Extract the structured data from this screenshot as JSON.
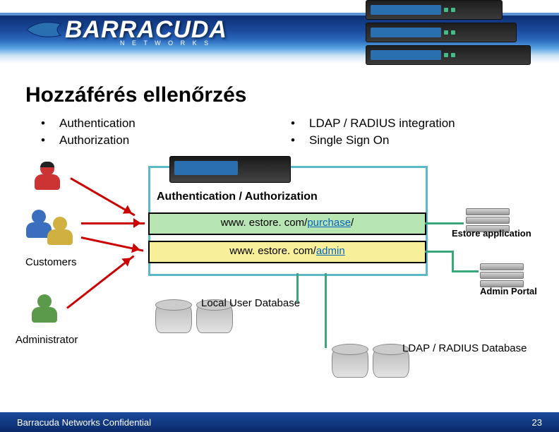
{
  "brand": {
    "name": "BARRACUDA",
    "sub": "N E T W O R K S"
  },
  "slide": {
    "title": "Hozzáférés ellenőrzés"
  },
  "bullets": {
    "left": [
      "Authentication",
      "Authorization"
    ],
    "right": [
      "LDAP / RADIUS integration",
      "Single Sign On"
    ]
  },
  "diagram": {
    "auth_label": "Authentication / Authorization",
    "url_purchase_pre": "www. estore. com/",
    "url_purchase_link": "purchase",
    "url_purchase_post": "/",
    "url_admin_pre": "www. estore. com/",
    "url_admin_link": "admin",
    "customers_label": "Customers",
    "admin_label": "Administrator",
    "estore_label": "Estore application",
    "admin_portal_label": "Admin Portal",
    "local_db_label": "Local User Database",
    "ldap_db_label": "LDAP / RADIUS Database"
  },
  "footer": {
    "confidential": "Barracuda Networks Confidential",
    "page": "23"
  }
}
